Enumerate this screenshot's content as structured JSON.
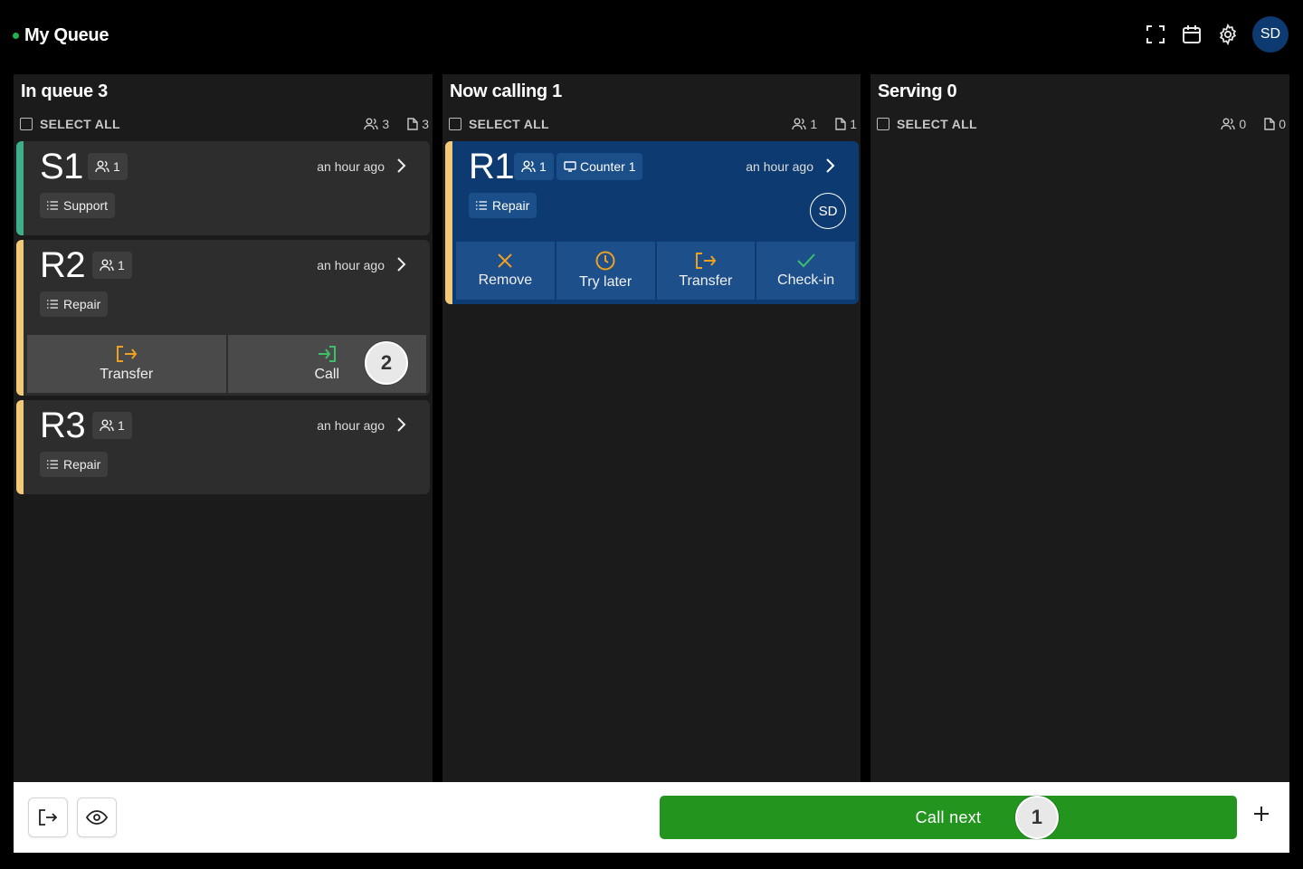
{
  "header": {
    "title": "My Queue",
    "avatar_initials": "SD",
    "icons": [
      "fullscreen-icon",
      "calendar-icon",
      "gear-icon"
    ]
  },
  "columns": [
    {
      "title": "In queue 3",
      "select_all": "SELECT ALL",
      "people_count": "3",
      "ticket_count": "3",
      "cards": [
        {
          "code": "S1",
          "party": "1",
          "time": "an hour ago",
          "service": "Support",
          "stripe": "#3fae8a"
        },
        {
          "code": "R2",
          "party": "1",
          "time": "an hour ago",
          "service": "Repair",
          "stripe": "#f2c879",
          "actions": [
            {
              "label": "Transfer",
              "icon": "transfer-icon"
            },
            {
              "label": "Call",
              "icon": "call-in-icon"
            }
          ],
          "step_badge": "2"
        },
        {
          "code": "R3",
          "party": "1",
          "time": "an hour ago",
          "service": "Repair",
          "stripe": "#f2c879"
        }
      ]
    },
    {
      "title": "Now calling 1",
      "select_all": "SELECT ALL",
      "people_count": "1",
      "ticket_count": "1",
      "cards": [
        {
          "code": "R1",
          "party": "1",
          "counter": "Counter 1",
          "time": "an hour ago",
          "service": "Repair",
          "stripe": "#f2c879",
          "assignee": "SD",
          "actions": [
            {
              "label": "Remove",
              "icon": "close-icon"
            },
            {
              "label": "Try later",
              "icon": "clock-icon"
            },
            {
              "label": "Transfer",
              "icon": "transfer-icon"
            },
            {
              "label": "Check-in",
              "icon": "check-icon"
            }
          ]
        }
      ]
    },
    {
      "title": "Serving 0",
      "select_all": "SELECT ALL",
      "people_count": "0",
      "ticket_count": "0",
      "cards": []
    }
  ],
  "bottom": {
    "call_next_label": "Call next",
    "step_badge": "1"
  },
  "colors": {
    "accent_green": "#23941e",
    "calling_blue": "#0d3a70",
    "transfer_orange": "#f0a020",
    "support_stripe": "#3fae8a",
    "repair_stripe": "#f2c879"
  }
}
